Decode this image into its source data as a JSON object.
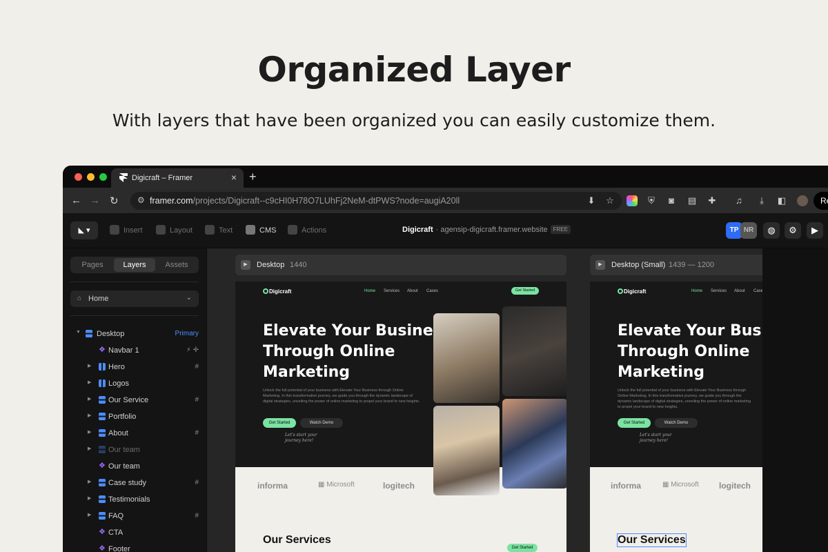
{
  "headline": "Organized Layer",
  "subhead": "With layers that have been organized you can easily customize them.",
  "browser": {
    "tab_title": "Digicraft – Framer",
    "url_domain": "framer.com",
    "url_path": "/projects/Digicraft--c9cHI0H78O7LUhFj2NeM-dtPWS?node=augiA20ll",
    "profile_label": "Re"
  },
  "framer": {
    "toolbar": {
      "insert": "Insert",
      "layout": "Layout",
      "text": "Text",
      "cms": "CMS",
      "actions": "Actions"
    },
    "project_name": "Digicraft",
    "project_domain": "· agensip-digicraft.framer.website",
    "plan_badge": "FREE",
    "avatars": [
      "TP",
      "NR"
    ],
    "panel_tabs": [
      "Pages",
      "Layers",
      "Assets"
    ],
    "active_tab": "Layers",
    "page_select": "Home",
    "layers": [
      {
        "name": "Desktop",
        "tag": "Primary"
      },
      {
        "name": "Navbar 1",
        "tag": "⚡ ✛"
      },
      {
        "name": "Hero",
        "tag": "#"
      },
      {
        "name": "Logos",
        "tag": ""
      },
      {
        "name": "Our Service",
        "tag": "#"
      },
      {
        "name": "Portfolio",
        "tag": ""
      },
      {
        "name": "About",
        "tag": "#"
      },
      {
        "name": "Our team",
        "tag": ""
      },
      {
        "name": "Our team",
        "tag": ""
      },
      {
        "name": "Case study",
        "tag": "#"
      },
      {
        "name": "Testimonials",
        "tag": ""
      },
      {
        "name": "FAQ",
        "tag": "#"
      },
      {
        "name": "CTA",
        "tag": ""
      },
      {
        "name": "Footer",
        "tag": ""
      }
    ],
    "frames": [
      {
        "name": "Desktop",
        "size": "1440"
      },
      {
        "name": "Desktop (Small)",
        "size": "1439 — 1200"
      }
    ]
  },
  "site": {
    "logo": "Digicraft",
    "nav": [
      "Home",
      "Services",
      "About",
      "Cases"
    ],
    "nav_button": "Get Started",
    "hero_title": "Elevate Your Business\nThrough Online\nMarketing",
    "hero_title_small": "Elevate Your Bus\nThrough Online\nMarketing",
    "hero_text": "Unlock the full potential of your business with Elevate Your Business through Online Marketing. In this transformative journey, we guide you through the dynamic landscape of digital strategies, unveiling the power of online marketing to propel your brand to new heights.",
    "cta_primary": "Get Started",
    "cta_secondary": "Watch Demo",
    "note": "Let's start your\njourney here!",
    "brands": [
      "informa",
      "Microsoft",
      "logitech"
    ],
    "services_title": "Our Services",
    "services_button": "Get Started"
  },
  "colors": {
    "accent_green": "#7be3a2",
    "framer_blue": "#4c8dff",
    "page_bg": "#f1efea"
  }
}
